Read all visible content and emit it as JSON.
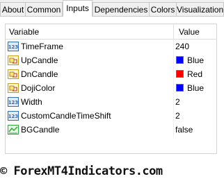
{
  "tabs": [
    {
      "label": "About",
      "active": false
    },
    {
      "label": "Common",
      "active": false
    },
    {
      "label": "Inputs",
      "active": true
    },
    {
      "label": "Dependencies",
      "active": false
    },
    {
      "label": "Colors",
      "active": false
    },
    {
      "label": "Visualization",
      "active": false
    }
  ],
  "table": {
    "columns": {
      "variable": "Variable",
      "value": "Value"
    },
    "rows": [
      {
        "name": "TimeFrame",
        "value": "240",
        "icon": "int-param-icon",
        "swatch": null
      },
      {
        "name": "UpCandle",
        "value": "Blue",
        "icon": "color-param-icon",
        "swatch": "#0000ff"
      },
      {
        "name": "DnCandle",
        "value": "Red",
        "icon": "color-param-icon",
        "swatch": "#ff0000"
      },
      {
        "name": "DojiColor",
        "value": "Blue",
        "icon": "color-param-icon",
        "swatch": "#0000ff"
      },
      {
        "name": "Width",
        "value": "2",
        "icon": "int-param-icon",
        "swatch": null
      },
      {
        "name": "CustomCandleTimeShift",
        "value": "2",
        "icon": "int-param-icon",
        "swatch": null
      },
      {
        "name": "BGCandle",
        "value": "false",
        "icon": "bool-param-icon",
        "swatch": null
      }
    ]
  },
  "watermark": "© ForexMT4Indicators.com",
  "colors": {
    "int_icon": "#2f6fb0",
    "color_icon_fill": "#ffe27a",
    "bool_icon": "#2fa83a"
  }
}
